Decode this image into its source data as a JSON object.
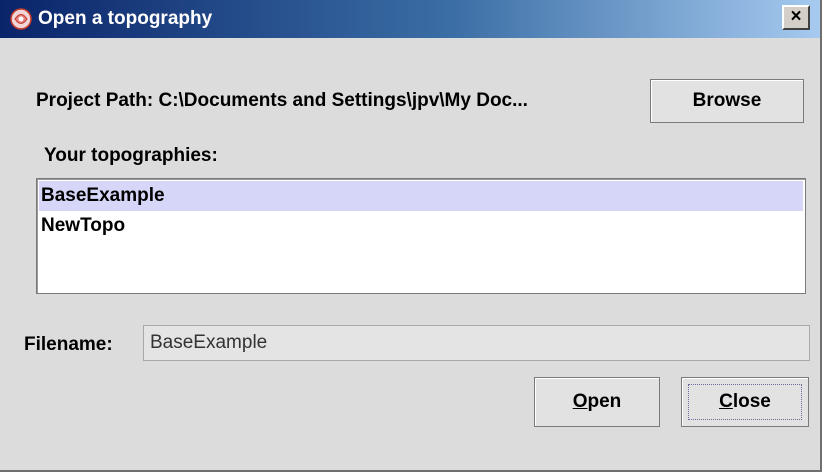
{
  "window": {
    "title": "Open a topography",
    "close_glyph": "×"
  },
  "project": {
    "label": "Project Path: C:\\Documents and Settings\\jpv\\My Doc...",
    "browse_label": "Browse"
  },
  "topographies": {
    "label": "Your topographies:",
    "items": [
      {
        "name": "BaseExample",
        "selected": true
      },
      {
        "name": "NewTopo",
        "selected": false
      }
    ]
  },
  "filename": {
    "label": "Filename:",
    "value": "BaseExample"
  },
  "actions": {
    "open_mnemonic": "O",
    "open_rest": "pen",
    "close_mnemonic": "C",
    "close_rest": "lose"
  },
  "colors": {
    "title_start": "#0a246a",
    "title_end": "#a6caf0",
    "selection": "#d6d6f8",
    "background": "#dcdcdc"
  },
  "icons": {
    "app": "java-app-icon",
    "close": "close-icon"
  }
}
